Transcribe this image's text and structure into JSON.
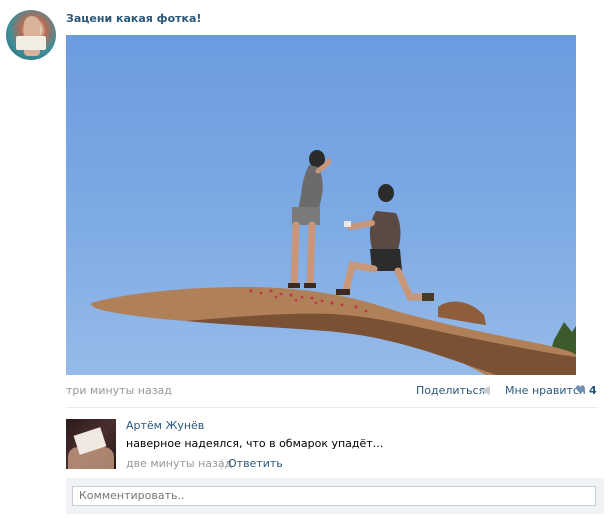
{
  "post": {
    "title": "Зацени какая фотка!",
    "time": "три минуты назад",
    "share_label": "Поделиться",
    "like_label": "Мне нравится",
    "like_count": "4"
  },
  "comment": {
    "author": "Артём Жунёв",
    "text": "наверное надеялся, что в обмарок упадёт...",
    "time": "две минуты назад",
    "separator": "|",
    "reply_label": "Ответить"
  },
  "composer": {
    "placeholder": "Комментировать.."
  },
  "colors": {
    "link": "#2b587a",
    "muted": "#999999",
    "sky": "#7eaae4"
  },
  "icons": {
    "share": "megaphone-icon",
    "like": "heart-icon"
  }
}
